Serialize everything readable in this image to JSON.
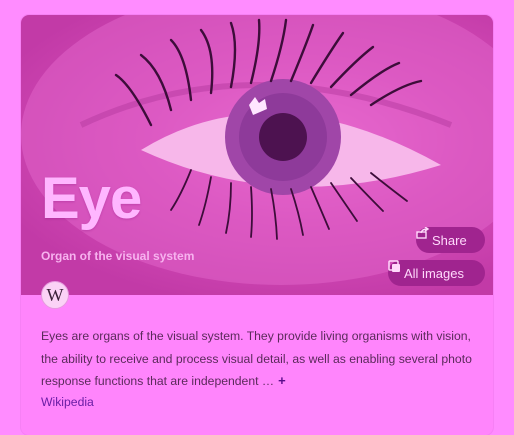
{
  "panel": {
    "title": "Eye",
    "subtitle": "Organ of the visual system",
    "share_label": "Share",
    "all_images_label": "All images",
    "source_badge": "W",
    "description": "Eyes are organs of the visual system. They provide living organisms with vision, the ability to receive and process visual detail, as well as enabling several photo response functions that are independent …",
    "more_label": "+",
    "source_label": "Wikipedia"
  },
  "colors": {
    "page_bg": "#ff8cff",
    "card_bg": "#ff85fc",
    "button_bg": "#a0248f",
    "link": "#6a1ea5"
  },
  "icons": {
    "share": "share-icon",
    "all_images": "images-icon",
    "more": "plus-icon"
  }
}
